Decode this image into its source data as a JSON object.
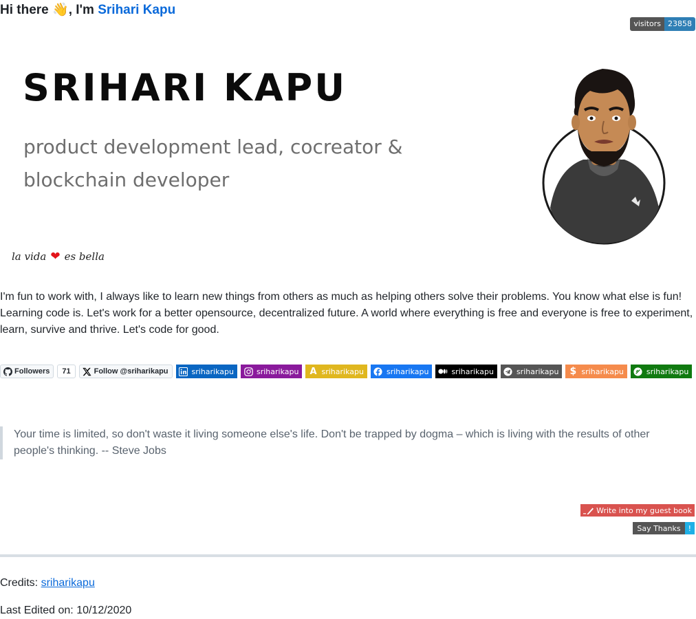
{
  "greeting": {
    "prefix": "Hi there",
    "wave": "👋",
    "middle": ", I'm",
    "name_link": "Srihari Kapu"
  },
  "visitors_badge": {
    "label": "visitors",
    "count": "23858",
    "color": "#2f7fb5"
  },
  "banner": {
    "name": "SRIHARI KAPU",
    "role_line1": "product development lead, cocreator &",
    "role_line2": "blockchain developer",
    "motto_left": "la vida",
    "motto_right": "es bella"
  },
  "about": "I'm fun to work with, I always like to learn new things from others as much as helping others solve their problems. You know what else is fun! Learning code is. Let's work for a better opensource, decentralized future. A world where everything is free and everyone is free to experiment, learn, survive and thrive. Let's code for good.",
  "badges": {
    "followers_label": "Followers",
    "followers_count": "71",
    "follow_x": "Follow @sriharikapu",
    "socials": [
      {
        "icon": "linkedin-icon",
        "label": "sriharikapu",
        "color": "#0a66c2"
      },
      {
        "icon": "instagram-icon",
        "label": "sriharikapu",
        "color": "#8a1a9c"
      },
      {
        "icon": "ae-icon",
        "label": "sriharikapu",
        "color": "#e0b71f"
      },
      {
        "icon": "facebook-icon",
        "label": "sriharikapu",
        "color": "#1877f2"
      },
      {
        "icon": "medium-icon",
        "label": "sriharikapu",
        "color": "#000000"
      },
      {
        "icon": "telegram-icon",
        "label": "sriharikapu",
        "color": "#555555"
      },
      {
        "icon": "stackshare-icon",
        "label": "sriharikapu",
        "color": "#f58b4c"
      },
      {
        "icon": "gitcoin-icon",
        "label": "sriharikapu",
        "color": "#107a10"
      }
    ]
  },
  "quote": "Your time is limited, so don't waste it living someone else's life. Don't be trapped by dogma – which is living with the results of other people's thinking. -- Steve Jobs",
  "guestbook_button": "Write into my guest book",
  "say_thanks": {
    "label": "Say Thanks",
    "mark": "!"
  },
  "credits": {
    "label": "Credits:",
    "link": "sriharikapu"
  },
  "last_edited": "Last Edited on: 10/12/2020"
}
